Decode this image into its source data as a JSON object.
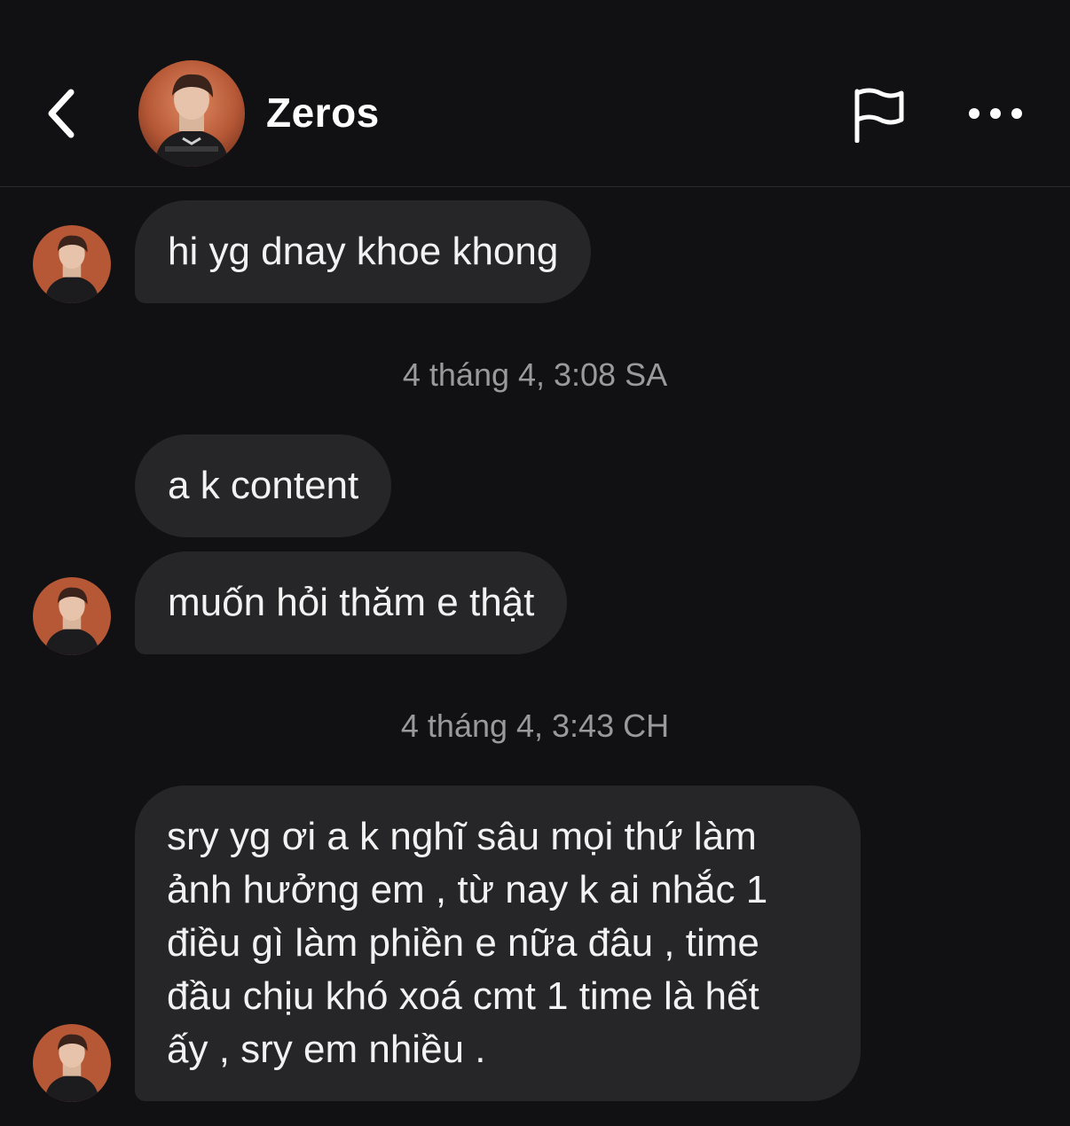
{
  "header": {
    "contact_name": "Zeros",
    "back_icon": "chevron-left-icon",
    "report_icon": "flag-icon",
    "more_icon": "more-horizontal-icon"
  },
  "messages": [
    {
      "type": "bubble",
      "text": "hi yg dnay khoe khong",
      "show_avatar": true
    },
    {
      "type": "timestamp",
      "text": "4 tháng 4, 3:08 SA"
    },
    {
      "type": "bubble",
      "text": "a k content",
      "show_avatar": false
    },
    {
      "type": "bubble",
      "text": "muốn hỏi thăm e thật",
      "show_avatar": true
    },
    {
      "type": "timestamp",
      "text": "4 tháng 4, 3:43 CH"
    },
    {
      "type": "bubble",
      "lines": [
        "sry yg ơi a k nghĩ sâu mọi thứ làm",
        "ảnh hưởng em , từ nay k ai nhắc 1",
        "điều gì làm phiền e nữa đâu , time",
        "đầu chịu khó xoá cmt 1 time là hết",
        "ấy , sry em nhiều ."
      ],
      "show_avatar": true
    }
  ],
  "colors": {
    "background": "#111113",
    "bubble": "#262628",
    "text": "#f2f2f2",
    "timestamp": "#9a9a9e"
  }
}
